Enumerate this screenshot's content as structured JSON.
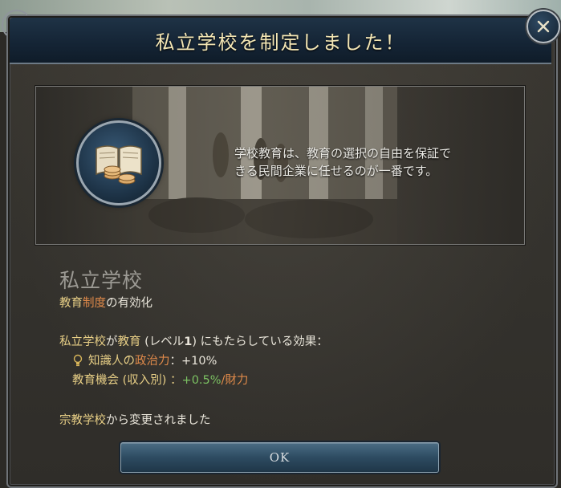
{
  "dialog": {
    "title": "私立学校を制定しました！",
    "close_icon": "close-icon",
    "flavor_text_line1": "学校教育は、教育の選択の自由を保証で",
    "flavor_text_line2": "きる民間企業に任せるのが一番です。",
    "law_name": "私立学校",
    "law_category_prefix": "教育",
    "law_category_highlight": "制度",
    "law_category_suffix": "の有効化",
    "effects_header_law": "私立学校",
    "effects_header_mid1": "が",
    "effects_header_institution": "教育",
    "effects_header_mid2": " (レベル",
    "effects_header_level": "1",
    "effects_header_end": ") にもたらしている効果：",
    "effect1_label_a": "知識人の",
    "effect1_label_b": "政治力",
    "effect1_value": "：+10%",
    "effect2_label": "教育機会 (収入別) ：",
    "effect2_value": "+0.5%",
    "effect2_unit": "/財力",
    "changed_from_law": "宗教学校",
    "changed_from_suffix": "から変更されました",
    "ok_label": "OK",
    "medallion_icon": "book-coins-icon",
    "bulb_icon": "lightbulb-icon"
  },
  "colors": {
    "title_bar": "#152536",
    "gold_text": "#e8cf86",
    "orange_text": "#e08a4a",
    "green_text": "#7bc062"
  }
}
